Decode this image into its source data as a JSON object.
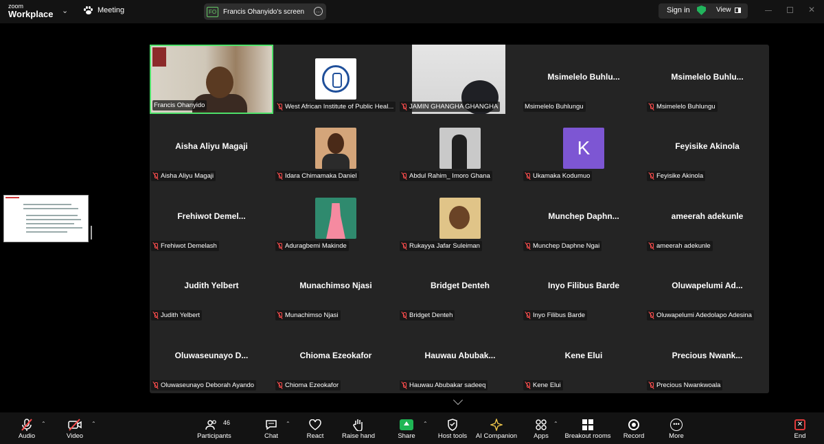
{
  "topbar": {
    "logo_small": "zoom",
    "logo_large": "Workplace",
    "meeting_label": "Meeting",
    "share_initials": "FO",
    "share_title": "Francis Ohanyido's screen",
    "sign_in": "Sign in",
    "view": "View",
    "security_color": "#21b45c"
  },
  "tiles": [
    {
      "name": "Francis Ohanyido",
      "big": "",
      "muted": false,
      "kind": "cam-francis",
      "active": true
    },
    {
      "name": "West African Institute of Public Heal...",
      "big": "",
      "muted": true,
      "kind": "logo"
    },
    {
      "name": "JAMIN GHANGHA GHANGHA",
      "big": "",
      "muted": true,
      "kind": "cam-jamin"
    },
    {
      "name": "Msimelelo Buhlungu",
      "big": "Msimelelo  Buhlu...",
      "muted": false,
      "kind": "name"
    },
    {
      "name": "Msimelelo Buhlungu",
      "big": "Msimelelo  Buhlu...",
      "muted": true,
      "kind": "name"
    },
    {
      "name": "Aisha Aliyu Magaji",
      "big": "Aisha Aliyu Magaji",
      "muted": true,
      "kind": "name"
    },
    {
      "name": "Idara Chimamaka Daniel",
      "big": "",
      "muted": true,
      "kind": "idara"
    },
    {
      "name": "Abdul Rahim_ Imoro Ghana",
      "big": "",
      "muted": true,
      "kind": "abdul"
    },
    {
      "name": "Ukamaka Kodumuo",
      "big": "",
      "muted": true,
      "kind": "k",
      "initial": "K"
    },
    {
      "name": "Feyisike Akinola",
      "big": "Feyisike Akinola",
      "muted": true,
      "kind": "name"
    },
    {
      "name": "Frehiwot Demelash",
      "big": "Frehiwot  Demel...",
      "muted": true,
      "kind": "name"
    },
    {
      "name": "Aduragbemi Makinde",
      "big": "",
      "muted": true,
      "kind": "adu"
    },
    {
      "name": "Rukayya Jafar Suleiman",
      "big": "",
      "muted": true,
      "kind": "ruk"
    },
    {
      "name": "Munchep Daphne Ngai",
      "big": "Munchep  Daphn...",
      "muted": true,
      "kind": "name"
    },
    {
      "name": "ameerah adekunle",
      "big": "ameerah adekunle",
      "muted": true,
      "kind": "name"
    },
    {
      "name": "Judith Yelbert",
      "big": "Judith Yelbert",
      "muted": true,
      "kind": "name"
    },
    {
      "name": "Munachimso Njasi",
      "big": "Munachimso Njasi",
      "muted": true,
      "kind": "name"
    },
    {
      "name": "Bridget Denteh",
      "big": "Bridget Denteh",
      "muted": true,
      "kind": "name"
    },
    {
      "name": "Inyo Filibus  Barde",
      "big": "Inyo Filibus  Barde",
      "muted": true,
      "kind": "name"
    },
    {
      "name": "Oluwapelumi Adedolapo Adesina",
      "big": "Oluwapelumi  Ad...",
      "muted": true,
      "kind": "name"
    },
    {
      "name": "Oluwaseunayo Deborah Ayando",
      "big": "Oluwaseunayo  D...",
      "muted": true,
      "kind": "name"
    },
    {
      "name": "Chioma Ezeokafor",
      "big": "Chioma Ezeokafor",
      "muted": true,
      "kind": "name"
    },
    {
      "name": "Hauwau Abubakar sadeeq",
      "big": "Hauwau  Abubak...",
      "muted": true,
      "kind": "name"
    },
    {
      "name": "Kene Elui",
      "big": "Kene Elui",
      "muted": true,
      "kind": "name"
    },
    {
      "name": "Precious Nwankwoala",
      "big": "Precious  Nwank...",
      "muted": true,
      "kind": "name"
    }
  ],
  "toolbar": {
    "audio": "Audio",
    "video": "Video",
    "participants": "Participants",
    "participants_count": "46",
    "chat": "Chat",
    "react": "React",
    "raise_hand": "Raise hand",
    "share": "Share",
    "host_tools": "Host tools",
    "ai_companion": "AI Companion",
    "apps": "Apps",
    "breakout": "Breakout rooms",
    "record": "Record",
    "more": "More",
    "end": "End",
    "share_color": "#1fb655",
    "end_color": "#e23b3b",
    "mute_color": "#ff4d4d"
  }
}
